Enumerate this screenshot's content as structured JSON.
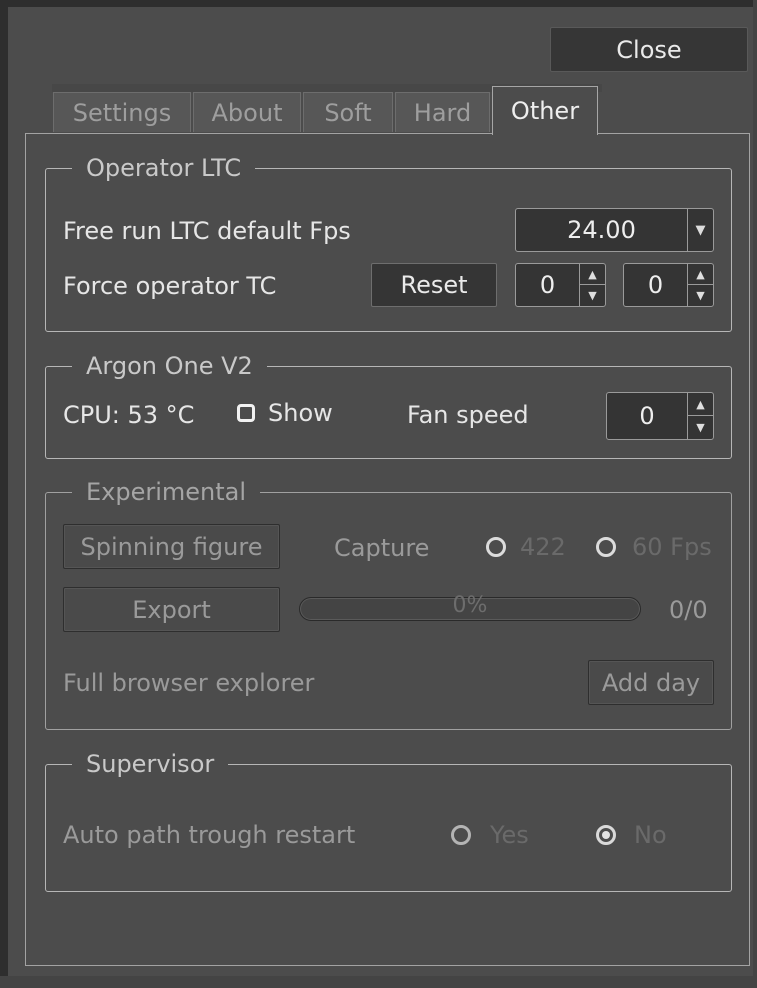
{
  "window": {
    "close_label": "Close"
  },
  "tabs": [
    {
      "label": "Settings"
    },
    {
      "label": "About"
    },
    {
      "label": "Soft"
    },
    {
      "label": "Hard"
    },
    {
      "label": "Other",
      "active": true
    }
  ],
  "operator_ltc": {
    "title": "Operator LTC",
    "fps_label": "Free run LTC default Fps",
    "fps_value": "24.00",
    "force_label": "Force operator TC",
    "reset_label": "Reset",
    "spin1_value": "0",
    "spin2_value": "0"
  },
  "argon": {
    "title": "Argon One V2",
    "cpu_label": "CPU: 53 °C",
    "show_label": "Show",
    "show_checked": false,
    "fan_label": "Fan speed",
    "fan_value": "0"
  },
  "experimental": {
    "title": "Experimental",
    "spinning_label": "Spinning figure",
    "capture_label": "Capture",
    "opt_422": "422",
    "opt_60fps": "60 Fps",
    "export_label": "Export",
    "progress_value": 0,
    "progress_text": "0%",
    "counter": "0/0",
    "browser_label": "Full browser explorer",
    "add_day_label": "Add day"
  },
  "supervisor": {
    "title": "Supervisor",
    "auto_label": "Auto path trough restart",
    "yes_label": "Yes",
    "no_label": "No",
    "selected": "No"
  }
}
